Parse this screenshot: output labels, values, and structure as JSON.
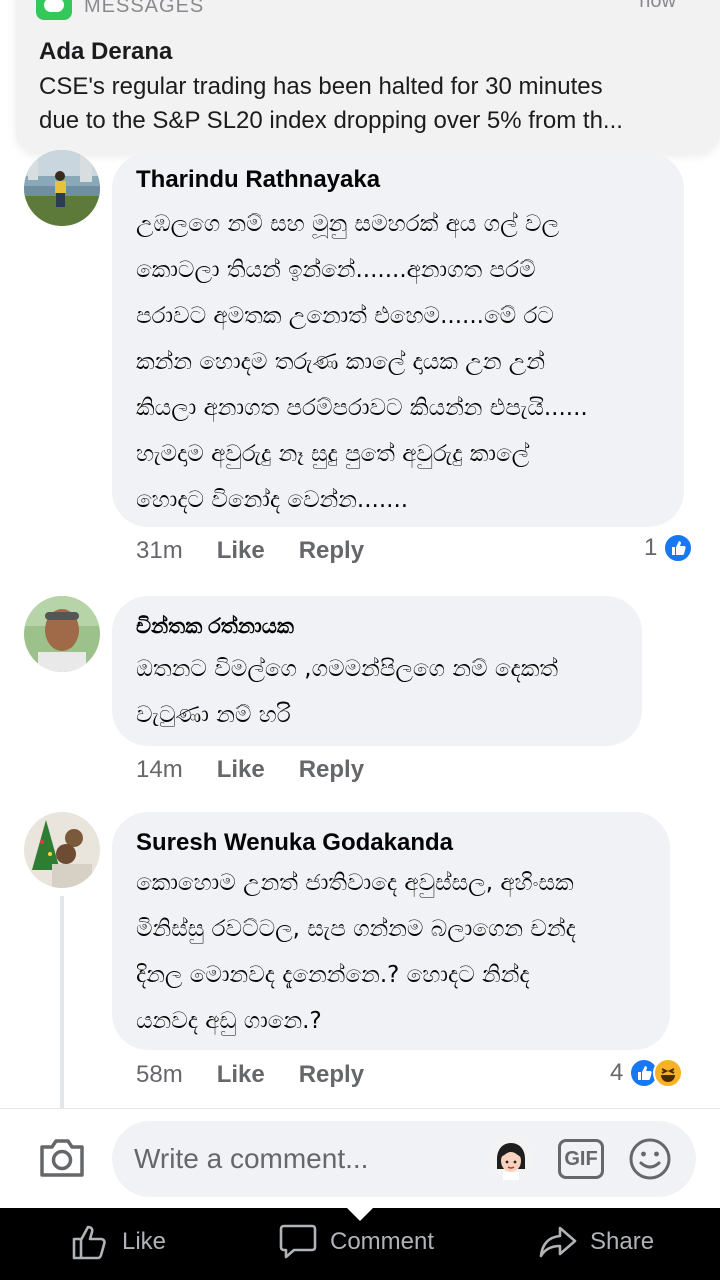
{
  "notification": {
    "app_name": "MESSAGES",
    "time": "now",
    "title": "Ada Derana",
    "body_lines": [
      "CSE's regular trading has been halted for 30 minutes",
      "due to the S&P SL20 index dropping over 5% from th..."
    ]
  },
  "comments": [
    {
      "author": "Tharindu Rathnayaka",
      "lines": [
        "උඹලගෙ නම් සහ මූනු සමහරක් අය ගල් වල",
        "කොටලා තියන් ඉන්නේ.......අනාගත පරම්",
        "පරාවට අමතක උනොත් එහෙම......මේ රට",
        "කන්න හොදම තරුණ කාලේ දායක උන උන්",
        "කියලා අනාගත පරම්පරාවට කියන්න එපැයි......",
        "හැමදාම අවුරුදු නෑ සුදු පුතේ අවුරුදු කාලේ",
        "හොදට විනෝද වෙන්න......."
      ],
      "time": "31m",
      "like": "Like",
      "reply": "Reply",
      "reaction_count": "1"
    },
    {
      "author": "චින්තක රත්නායක",
      "lines": [
        "ඔතනට විමල්ගෙ ,ගමමන්පිලගෙ නම් දෙකත්",
        "වැටුණා නම් හරි"
      ],
      "time": "14m",
      "like": "Like",
      "reply": "Reply"
    },
    {
      "author": "Suresh Wenuka Godakanda",
      "lines": [
        "කොහොම උනත් ජාතිවාදෙ අවුස්සල, අහිංසක",
        "මිනිස්සු රවට්ටල, සැප ගන්නම බලාගෙන චන්ද",
        "දිනල මොනවද දැනෙන්නෙ.? හොදට නින්ද",
        "යනවද අඩු ගානෙ.?"
      ],
      "time": "58m",
      "like": "Like",
      "reply": "Reply",
      "reaction_count": "4"
    }
  ],
  "composer": {
    "placeholder": "Write a comment...",
    "gif_label": "GIF"
  },
  "bottom_bar": {
    "like": "Like",
    "comment": "Comment",
    "share": "Share"
  },
  "colors": {
    "bubble": "#f0f2f5",
    "facebook_blue": "#1877f2",
    "meta_gray": "#65676b",
    "bottom_bar": "#000000",
    "notification_bg": "#f2f2f3"
  }
}
